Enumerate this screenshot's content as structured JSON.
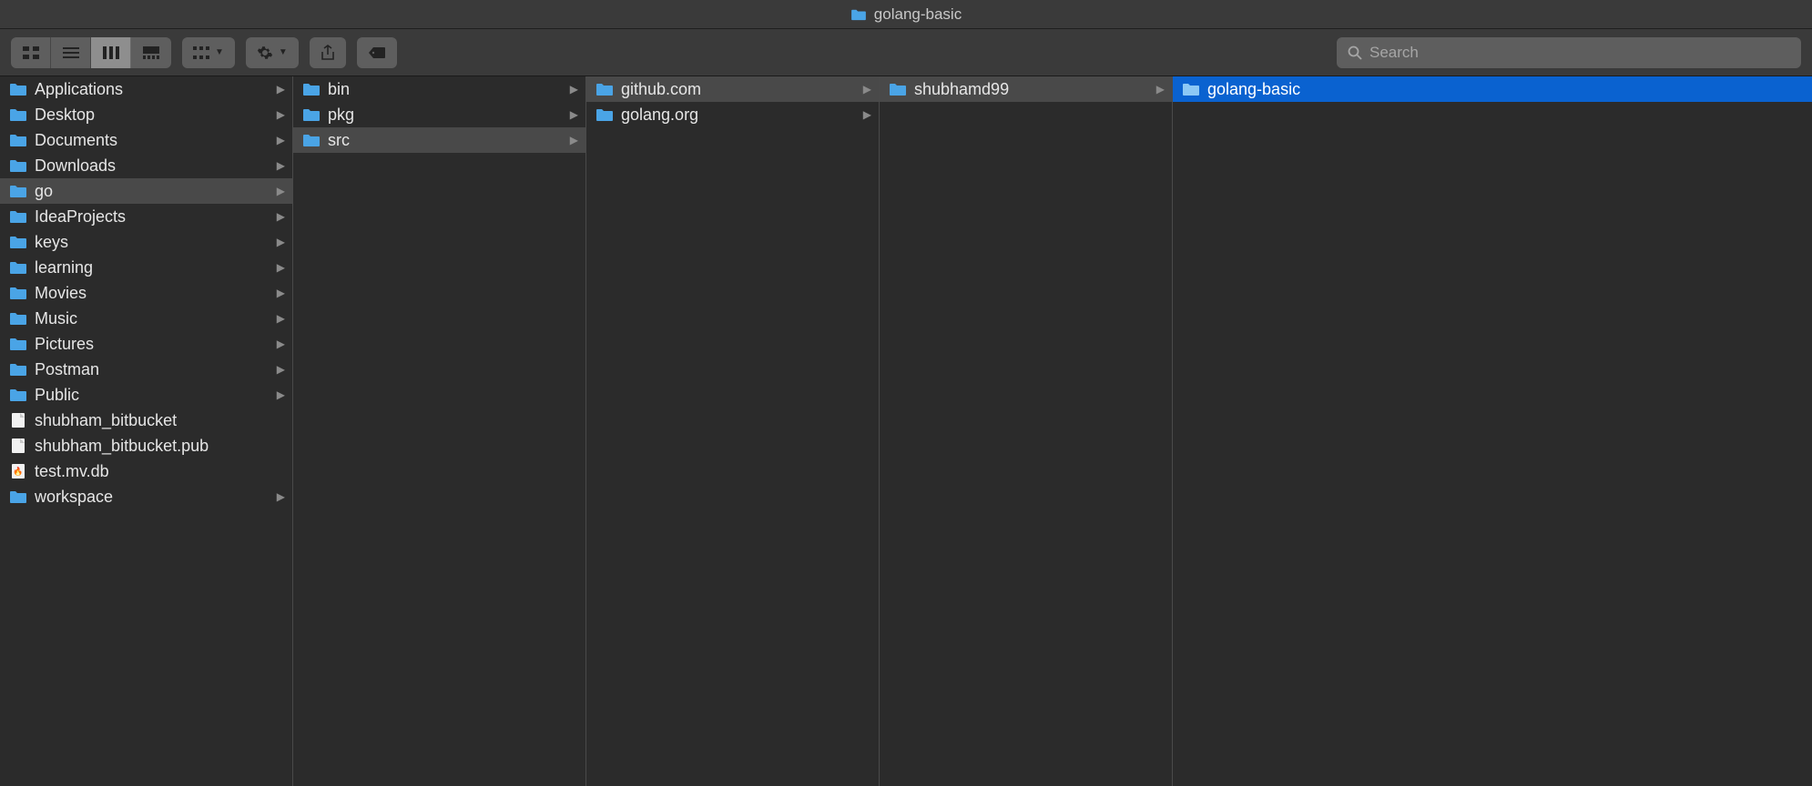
{
  "window": {
    "title": "golang-basic"
  },
  "search": {
    "placeholder": "Search"
  },
  "columns": [
    {
      "items": [
        {
          "name": "Applications",
          "type": "folder-special",
          "hasChildren": true,
          "selected": ""
        },
        {
          "name": "Desktop",
          "type": "folder",
          "hasChildren": true,
          "selected": ""
        },
        {
          "name": "Documents",
          "type": "folder",
          "hasChildren": true,
          "selected": ""
        },
        {
          "name": "Downloads",
          "type": "folder-download",
          "hasChildren": true,
          "selected": ""
        },
        {
          "name": "go",
          "type": "folder",
          "hasChildren": true,
          "selected": "path"
        },
        {
          "name": "IdeaProjects",
          "type": "folder",
          "hasChildren": true,
          "selected": ""
        },
        {
          "name": "keys",
          "type": "folder",
          "hasChildren": true,
          "selected": ""
        },
        {
          "name": "learning",
          "type": "folder",
          "hasChildren": true,
          "selected": ""
        },
        {
          "name": "Movies",
          "type": "folder",
          "hasChildren": true,
          "selected": ""
        },
        {
          "name": "Music",
          "type": "folder",
          "hasChildren": true,
          "selected": ""
        },
        {
          "name": "Pictures",
          "type": "folder",
          "hasChildren": true,
          "selected": ""
        },
        {
          "name": "Postman",
          "type": "folder",
          "hasChildren": true,
          "selected": ""
        },
        {
          "name": "Public",
          "type": "folder",
          "hasChildren": true,
          "selected": ""
        },
        {
          "name": "shubham_bitbucket",
          "type": "file",
          "hasChildren": false,
          "selected": ""
        },
        {
          "name": "shubham_bitbucket.pub",
          "type": "file",
          "hasChildren": false,
          "selected": ""
        },
        {
          "name": "test.mv.db",
          "type": "file-db",
          "hasChildren": false,
          "selected": ""
        },
        {
          "name": "workspace",
          "type": "folder",
          "hasChildren": true,
          "selected": ""
        }
      ]
    },
    {
      "items": [
        {
          "name": "bin",
          "type": "folder",
          "hasChildren": true,
          "selected": ""
        },
        {
          "name": "pkg",
          "type": "folder",
          "hasChildren": true,
          "selected": ""
        },
        {
          "name": "src",
          "type": "folder",
          "hasChildren": true,
          "selected": "path"
        }
      ]
    },
    {
      "items": [
        {
          "name": "github.com",
          "type": "folder",
          "hasChildren": true,
          "selected": "path"
        },
        {
          "name": "golang.org",
          "type": "folder",
          "hasChildren": true,
          "selected": ""
        }
      ]
    },
    {
      "items": [
        {
          "name": "shubhamd99",
          "type": "folder",
          "hasChildren": true,
          "selected": "path"
        }
      ]
    },
    {
      "items": [
        {
          "name": "golang-basic",
          "type": "folder",
          "hasChildren": false,
          "selected": "active"
        }
      ]
    }
  ]
}
